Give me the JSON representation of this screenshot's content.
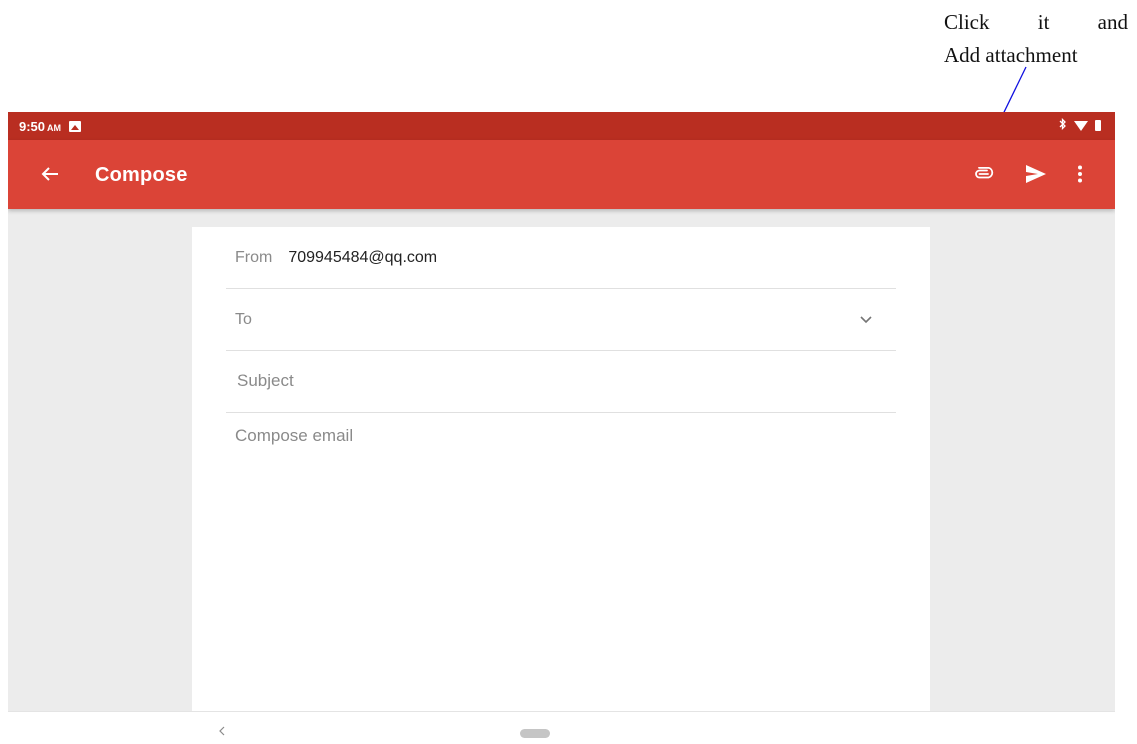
{
  "annotation": {
    "line1_words": [
      "Click",
      "it",
      "and"
    ],
    "line2": "Add attachment",
    "arrow_color": "#1010e0"
  },
  "status_bar": {
    "time": "9:50",
    "ampm": "AM",
    "icons": [
      "image-icon",
      "bluetooth-icon",
      "wifi-icon",
      "battery-icon"
    ]
  },
  "app_bar": {
    "title": "Compose",
    "actions": [
      "back-arrow-icon",
      "paperclip-icon",
      "send-icon",
      "more-vert-icon"
    ],
    "color": "#db4437",
    "status_color": "#b92e21"
  },
  "compose": {
    "from_label": "From",
    "from_value": "709945484@qq.com",
    "to_label": "To",
    "to_value": "",
    "subject_placeholder": "Subject",
    "subject_value": "",
    "body_placeholder": "Compose email",
    "body_value": ""
  },
  "nav_bar": {
    "icons": [
      "back-chevron-icon",
      "home-pill-icon"
    ]
  }
}
